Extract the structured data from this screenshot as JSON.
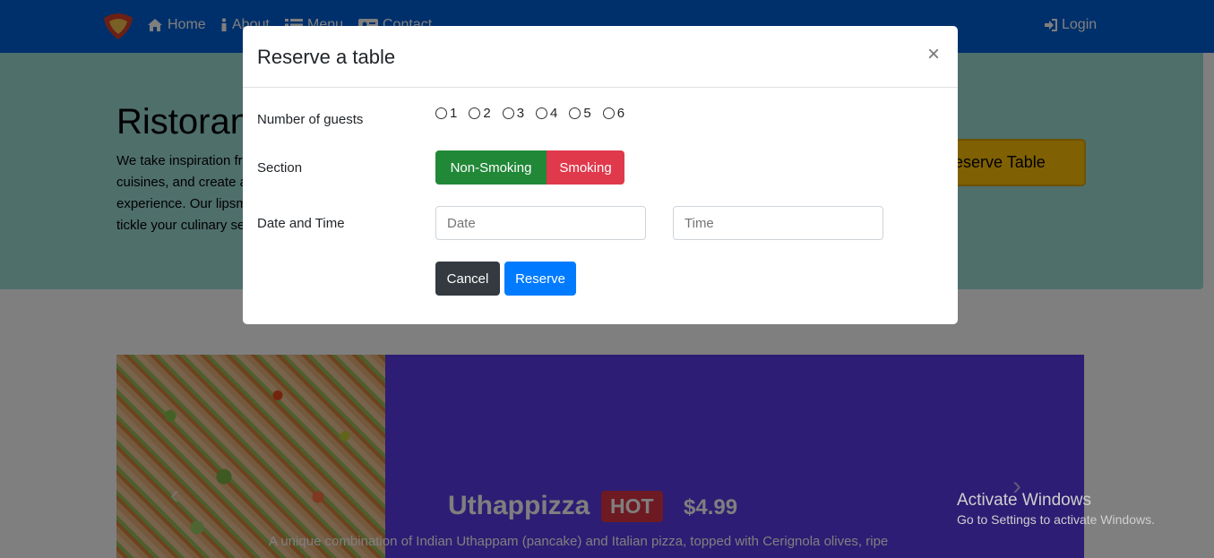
{
  "navbar": {
    "items": [
      {
        "label": "Home",
        "icon": "home-icon"
      },
      {
        "label": "About",
        "icon": "info-icon"
      },
      {
        "label": "Menu",
        "icon": "list-icon"
      },
      {
        "label": "Contact",
        "icon": "address-card-icon"
      }
    ],
    "login_label": "Login",
    "colors": {
      "background": "#0160d6"
    }
  },
  "jumbotron": {
    "title": "Ristorante",
    "text": "We take inspiration from the World's best cuisines, and create a unique fusion experience. Our lipsmacking creations will tickle your culinary senses!",
    "reserve_button": "Reserve Table"
  },
  "carousel": {
    "dish_name": "Uthappizza",
    "badge": "HOT",
    "price": "$4.99",
    "description": "A unique combination of Indian Uthappam (pancake) and Italian pizza, topped with Cerignola olives, ripe"
  },
  "modal": {
    "title": "Reserve a table",
    "close_label": "×",
    "guests_label": "Number of guests",
    "guest_options": [
      "1",
      "2",
      "3",
      "4",
      "5",
      "6"
    ],
    "section_label": "Section",
    "section_options": [
      "Non-Smoking",
      "Smoking"
    ],
    "datetime_label": "Date and Time",
    "date_placeholder": "Date",
    "time_placeholder": "Time",
    "cancel_label": "Cancel",
    "reserve_label": "Reserve"
  },
  "watermark": {
    "title": "Activate Windows",
    "subtitle": "Go to Settings to activate Windows."
  }
}
